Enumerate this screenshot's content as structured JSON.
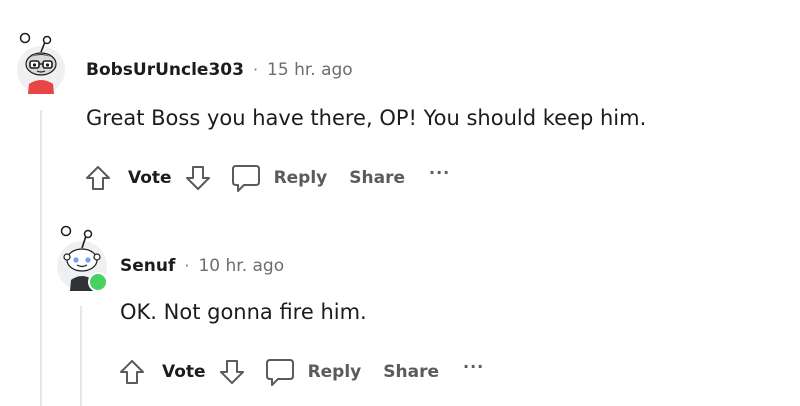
{
  "comments": [
    {
      "author": "BobsUrUncle303",
      "separator": "·",
      "time": "15 hr. ago",
      "text": "Great Boss you have there, OP! You should keep him.",
      "actions": {
        "vote": "Vote",
        "reply": "Reply",
        "share": "Share",
        "more": "···"
      },
      "avatar_icon": "snoo-glasses-avatar"
    },
    {
      "author": "Senuf",
      "separator": "·",
      "time": "10 hr. ago",
      "text": "OK. Not gonna fire him.",
      "actions": {
        "vote": "Vote",
        "reply": "Reply",
        "share": "Share",
        "more": "···"
      },
      "avatar_icon": "snoo-avatar",
      "online": true
    }
  ],
  "colors": {
    "thread_line": "#e4e6e8",
    "online_dot": "#46d160",
    "muted": "#6e6e6e"
  }
}
